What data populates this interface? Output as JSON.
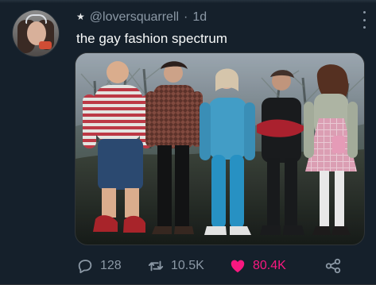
{
  "tweet": {
    "author": {
      "badge_icon": "star-icon",
      "handle": "@loversquarrell",
      "timestamp": "1d"
    },
    "text": "the gay fashion spectrum",
    "media": {
      "alt": "Five children in different outfits lined up side by side"
    },
    "actions": {
      "reply_count": "128",
      "retweet_count": "10.5K",
      "like_count": "80.4K"
    },
    "icons": {
      "reply": "reply-icon",
      "retweet": "retweet-icon",
      "like": "heart-icon",
      "share": "share-icon",
      "more": "more-icon"
    },
    "colors": {
      "background": "#15202b",
      "muted": "#8b98a5",
      "like_accent": "#f91880"
    }
  }
}
